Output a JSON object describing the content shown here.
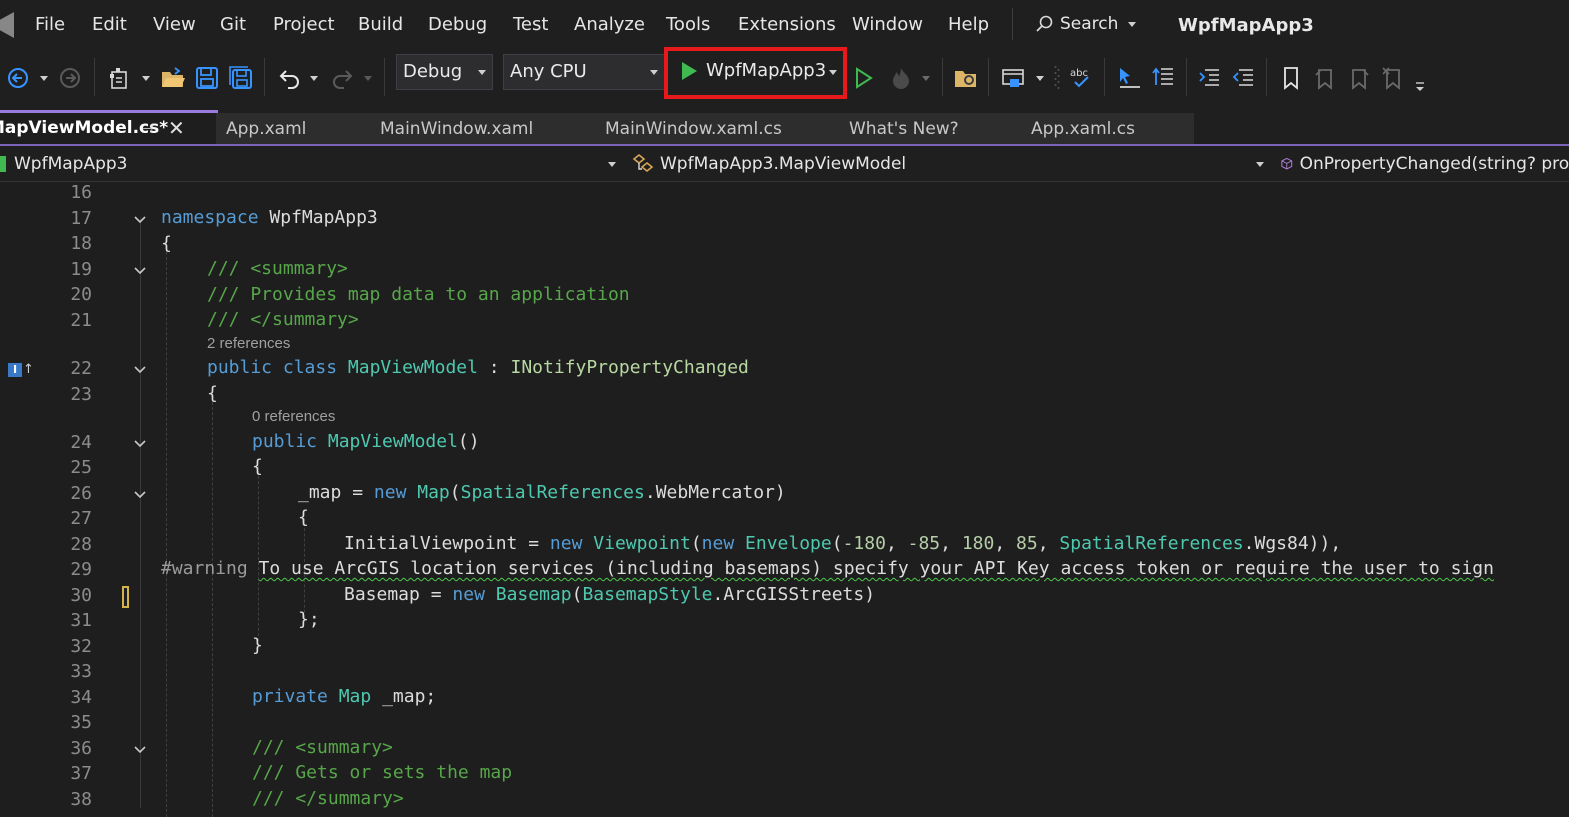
{
  "menu": {
    "items": [
      "File",
      "Edit",
      "View",
      "Git",
      "Project",
      "Build",
      "Debug",
      "Test",
      "Analyze",
      "Tools",
      "Extensions",
      "Window",
      "Help"
    ],
    "search_label": "Search",
    "solution_title": "WpfMapApp3"
  },
  "toolbar": {
    "configuration": "Debug",
    "platform": "Any CPU",
    "run_target": "WpfMapApp3",
    "colors": {
      "run_green": "#3fb950",
      "highlight_red": "#e8191b",
      "accent_blue": "#3794ff"
    }
  },
  "tabs": [
    {
      "label": "MapViewModel.cs*",
      "active": true
    },
    {
      "label": "App.xaml",
      "active": false
    },
    {
      "label": "MainWindow.xaml",
      "active": false
    },
    {
      "label": "MainWindow.xaml.cs",
      "active": false
    },
    {
      "label": "What's New?",
      "active": false
    },
    {
      "label": "App.xaml.cs",
      "active": false
    }
  ],
  "navbar": {
    "project": "WpfMapApp3",
    "type": "WpfMapApp3.MapViewModel",
    "member": "OnPropertyChanged(string? prop"
  },
  "editor": {
    "line_numbers": [
      "16",
      "17",
      "18",
      "19",
      "20",
      "21",
      "22",
      "23",
      "24",
      "25",
      "26",
      "27",
      "28",
      "29",
      "30",
      "31",
      "32",
      "33",
      "34",
      "35",
      "36",
      "37",
      "38"
    ],
    "lens": {
      "class_refs": "2 references",
      "ctor_refs": "0 references"
    },
    "lines": {
      "l17": [
        "namespace",
        "WpfMapApp3"
      ],
      "l18": [
        "{"
      ],
      "l19": [
        "/// <summary>"
      ],
      "l20": [
        "/// Provides map data to an application"
      ],
      "l21": [
        "/// </summary>"
      ],
      "l22": [
        "public",
        "class",
        "MapViewModel",
        ":",
        "INotifyPropertyChanged"
      ],
      "l23": [
        "{"
      ],
      "l24": [
        "public",
        "MapViewModel",
        "()"
      ],
      "l25": [
        "{"
      ],
      "l26": [
        "_map",
        "=",
        "new",
        "Map",
        "(",
        "SpatialReferences",
        ".",
        "WebMercator",
        ")"
      ],
      "l27": [
        "{"
      ],
      "l28": [
        "InitialViewpoint",
        "=",
        "new",
        "Viewpoint",
        "(",
        "new",
        "Envelope",
        "(",
        "-180",
        ",",
        "-85",
        ",",
        "180",
        ",",
        "85",
        ",",
        "SpatialReferences",
        ".",
        "Wgs84",
        ")),"
      ],
      "l29": [
        "#warning",
        "To use ArcGIS location services (including basemaps) specify your API Key access token or require the user to sign"
      ],
      "l30": [
        "Basemap",
        "=",
        "new",
        "Basemap",
        "(",
        "BasemapStyle",
        ".",
        "ArcGISStreets",
        ")"
      ],
      "l31": [
        "};"
      ],
      "l32": [
        "}"
      ],
      "l34": [
        "private",
        "Map",
        "_map;"
      ],
      "l36": [
        "/// <summary>"
      ],
      "l37": [
        "/// Gets or sets the map"
      ],
      "l38": [
        "/// </summary>"
      ]
    }
  }
}
